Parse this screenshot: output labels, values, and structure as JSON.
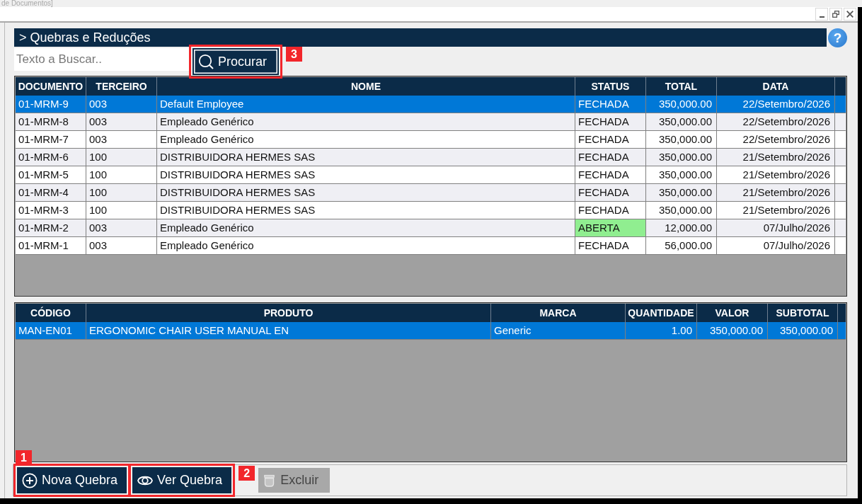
{
  "window": {
    "title": "de Documentos]"
  },
  "header": {
    "title": "> Quebras e Reduções",
    "help": "?"
  },
  "search": {
    "placeholder": "Texto a Buscar..",
    "button": {
      "label": "Procurar",
      "focused": true,
      "callout": "3"
    }
  },
  "documents": {
    "columns": [
      "DOCUMENTO",
      "TERCEIRO",
      "NOME",
      "STATUS",
      "TOTAL",
      "DATA"
    ],
    "rows": [
      {
        "cells": [
          "01-MRM-9",
          "003",
          "Default Employee",
          "FECHADA",
          "350,000.00",
          "22/Setembro/2026"
        ],
        "selected": true,
        "status_highlighted": false
      },
      {
        "cells": [
          "01-MRM-8",
          "003",
          "Empleado Genérico",
          "FECHADA",
          "350,000.00",
          "22/Setembro/2026"
        ],
        "selected": false,
        "status_highlighted": false
      },
      {
        "cells": [
          "01-MRM-7",
          "003",
          "Empleado Genérico",
          "FECHADA",
          "350,000.00",
          "22/Setembro/2026"
        ],
        "selected": false,
        "status_highlighted": false
      },
      {
        "cells": [
          "01-MRM-6",
          "100",
          "DISTRIBUIDORA HERMES SAS",
          "FECHADA",
          "350,000.00",
          "21/Setembro/2026"
        ],
        "selected": false,
        "status_highlighted": false
      },
      {
        "cells": [
          "01-MRM-5",
          "100",
          "DISTRIBUIDORA HERMES SAS",
          "FECHADA",
          "350,000.00",
          "21/Setembro/2026"
        ],
        "selected": false,
        "status_highlighted": false
      },
      {
        "cells": [
          "01-MRM-4",
          "100",
          "DISTRIBUIDORA HERMES SAS",
          "FECHADA",
          "350,000.00",
          "21/Setembro/2026"
        ],
        "selected": false,
        "status_highlighted": false
      },
      {
        "cells": [
          "01-MRM-3",
          "100",
          "DISTRIBUIDORA HERMES SAS",
          "FECHADA",
          "350,000.00",
          "21/Setembro/2026"
        ],
        "selected": false,
        "status_highlighted": false
      },
      {
        "cells": [
          "01-MRM-2",
          "003",
          "Empleado Genérico",
          "ABERTA",
          "12,000.00",
          "07/Julho/2026"
        ],
        "selected": false,
        "status_highlighted": true
      },
      {
        "cells": [
          "01-MRM-1",
          "003",
          "Empleado Genérico",
          "FECHADA",
          "56,000.00",
          "07/Julho/2026"
        ],
        "selected": false,
        "status_highlighted": false
      }
    ]
  },
  "items": {
    "columns": [
      "CÓDIGO",
      "PRODUTO",
      "MARCA",
      "QUANTIDADE",
      "VALOR",
      "SUBTOTAL"
    ],
    "rows": [
      {
        "cells": [
          "MAN-EN01",
          "ERGONOMIC CHAIR USER MANUAL EN",
          "Generic",
          "1.00",
          "350,000.00",
          "350,000.00"
        ],
        "selected": true
      }
    ]
  },
  "actions": [
    {
      "kind": "add",
      "label": "Nova Quebra",
      "disabled": false,
      "focused": false,
      "callout": "1"
    },
    {
      "kind": "view",
      "label": "Ver Quebra",
      "disabled": false,
      "focused": false,
      "callout": "2"
    },
    {
      "kind": "delete",
      "label": "Excluir",
      "disabled": true,
      "focused": false
    }
  ]
}
